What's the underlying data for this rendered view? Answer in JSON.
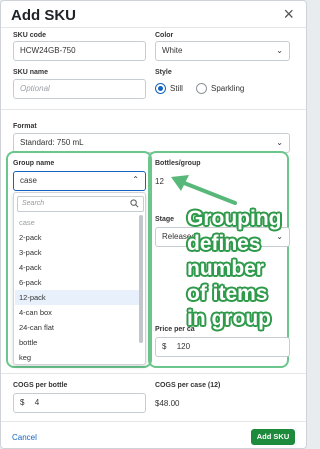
{
  "dialog": {
    "title": "Add SKU",
    "close_label": "×"
  },
  "sku_code": {
    "label": "SKU code",
    "value": "HCW24GB-750"
  },
  "color": {
    "label": "Color",
    "value": "White"
  },
  "sku_name": {
    "label": "SKU name",
    "placeholder": "Optional"
  },
  "style": {
    "label": "Style",
    "options": [
      "Still",
      "Sparkling"
    ],
    "selected": "Still"
  },
  "format": {
    "label": "Format",
    "value": "Standard: 750 mL"
  },
  "group_name": {
    "label": "Group name",
    "value": "case",
    "search_placeholder": "Search",
    "options": [
      "case",
      "2-pack",
      "3-pack",
      "4-pack",
      "6-pack",
      "12-pack",
      "4-can box",
      "24-can flat",
      "bottle",
      "keg"
    ],
    "highlighted": "12-pack"
  },
  "bottles_group": {
    "label": "Bottles/group",
    "value": "12"
  },
  "stage": {
    "label": "Stage",
    "value": "Released"
  },
  "price_per_case": {
    "label": "Price per ca",
    "currency": "$",
    "value": "120"
  },
  "cogs_per_bottle": {
    "label": "COGS per bottle",
    "currency": "$",
    "value": "4"
  },
  "cogs_per_case": {
    "label": "COGS per case (12)",
    "value": "$48.00"
  },
  "annotation": {
    "text_lines": [
      "Grouping",
      "defines",
      "number",
      "of items",
      "in group"
    ]
  },
  "footer": {
    "cancel_label": "Cancel",
    "submit_label": "Add SKU"
  },
  "colors": {
    "primary_blue": "#1565c0",
    "accent_green": "#1e8a3c",
    "callout_green": "#6bc68c"
  }
}
